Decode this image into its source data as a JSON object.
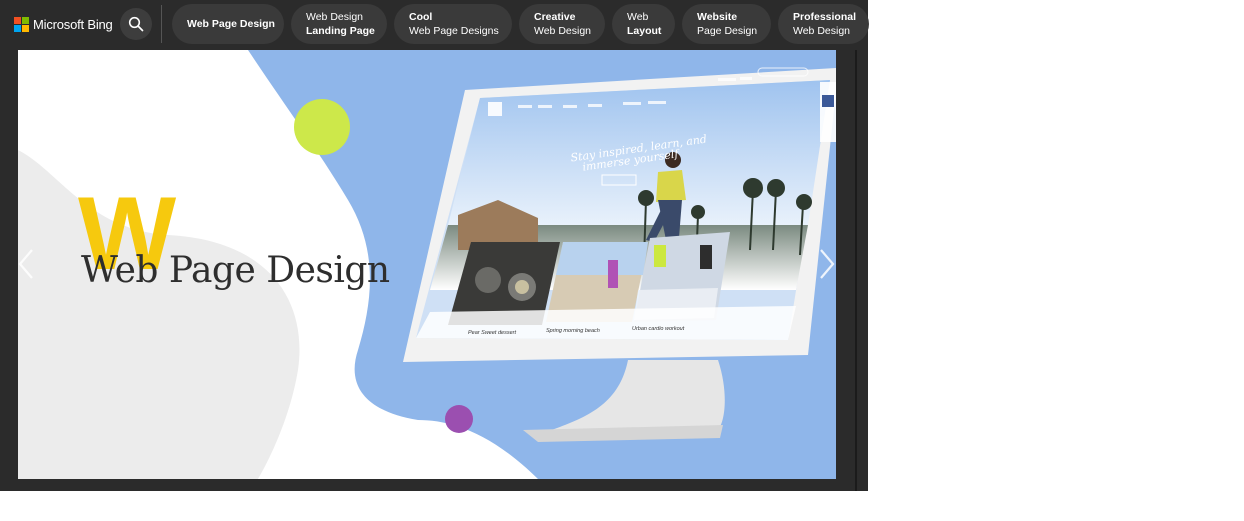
{
  "brand": {
    "name": "Microsoft Bing"
  },
  "search": {
    "icon": "search-icon"
  },
  "chips": [
    {
      "line1": "Web Page Design",
      "line2": ""
    },
    {
      "line1": "Web Design",
      "line2": "Landing Page"
    },
    {
      "line1": "Cool",
      "line2": "Web Page Designs"
    },
    {
      "line1": "Creative",
      "line2": "Web Design"
    },
    {
      "line1": "Web",
      "line2": "Layout"
    },
    {
      "line1": "Website",
      "line2": "Page Design"
    },
    {
      "line1": "Professional",
      "line2": "Web Design"
    }
  ],
  "hero": {
    "big_letter": "W",
    "title": "Web Page Design"
  },
  "monitor": {
    "headline_1": "Stay inspired, learn, and",
    "headline_2": "immerse yourself",
    "cta": "LEARN MORE",
    "captions": [
      "Pear Sweet dessert",
      "Spring morning beach",
      "Urban cardio workout"
    ]
  },
  "colors": {
    "panel_bg": "#2b2b2b",
    "chip_bg": "#3a3a3a",
    "blob_blue": "#8fb6ea",
    "lime": "#cde84a",
    "purple": "#9b4fb0",
    "yellow": "#f6c90e"
  }
}
